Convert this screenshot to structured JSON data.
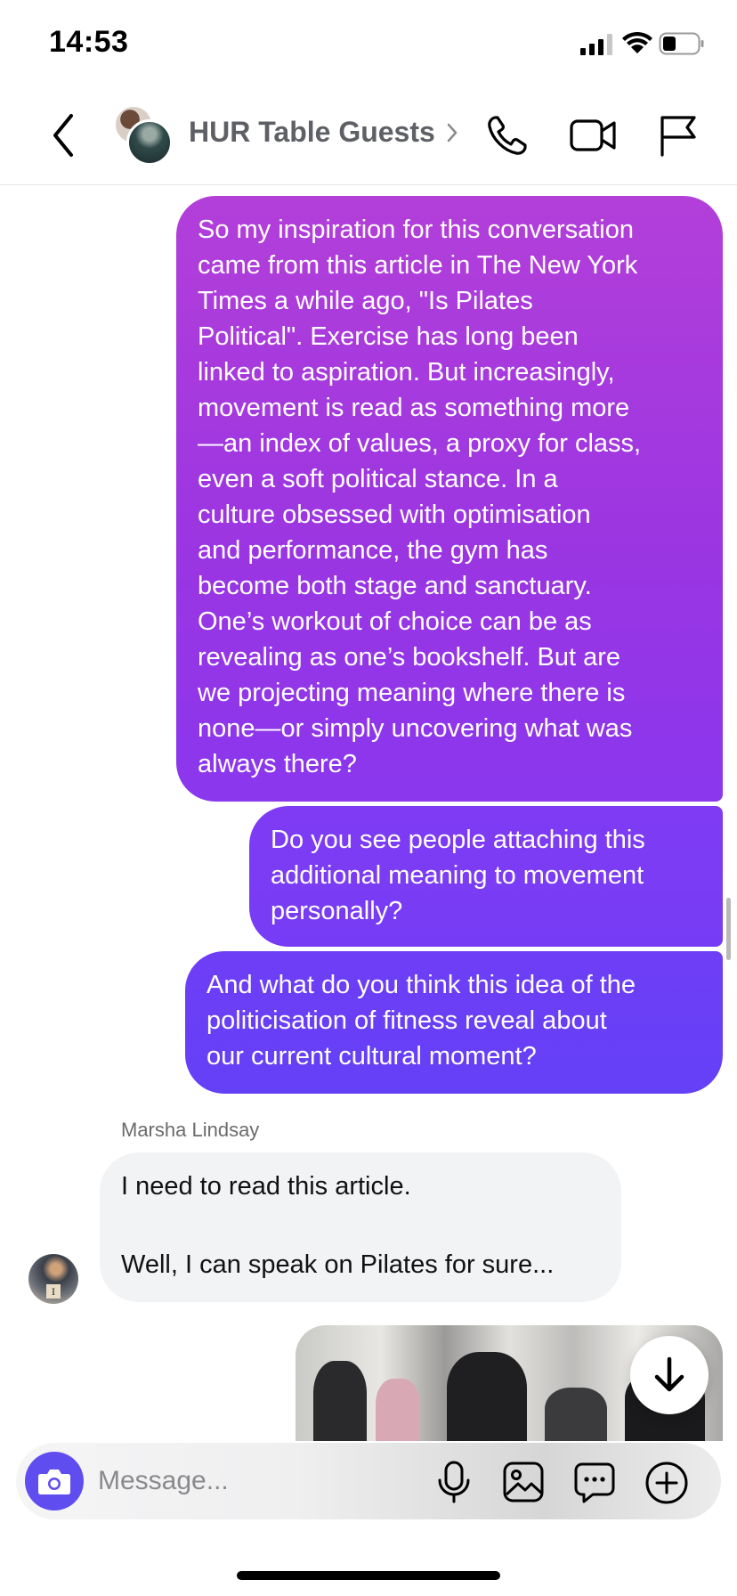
{
  "status_bar": {
    "time": "14:53"
  },
  "header": {
    "title": "HUR Table Guests",
    "icons": [
      "back-arrow-icon",
      "chevron-right-icon",
      "phone-icon",
      "video-camera-icon",
      "flag-icon"
    ]
  },
  "messages": [
    {
      "direction": "outgoing",
      "lines": [
        "So my inspiration for this conversation",
        "came from this article in The New York",
        "Times a while ago, \"Is Pilates",
        "Political\". Exercise has long been",
        "linked to aspiration. But increasingly,",
        "movement is read as something more",
        "—an index of values, a proxy for class,",
        "even a soft political stance. In a",
        "culture obsessed with optimisation",
        "and performance, the gym has",
        "become both stage and sanctuary.",
        "One’s workout of choice can be as",
        "revealing as one’s bookshelf. But are",
        "we projecting meaning where there is",
        "none—or simply uncovering what was",
        "always there?"
      ]
    },
    {
      "direction": "outgoing",
      "lines": [
        "Do you see people attaching this",
        "additional meaning to movement",
        "personally?"
      ]
    },
    {
      "direction": "outgoing",
      "lines": [
        "And what do you think this idea of the",
        "politicisation of fitness reveal about",
        "our current cultural moment?"
      ]
    },
    {
      "direction": "incoming",
      "sender": "Marsha Lindsay",
      "avatar_badge": "I",
      "paragraphs": [
        "I need to read this article.",
        "Well, I can speak on Pilates for sure..."
      ]
    }
  ],
  "composer": {
    "placeholder": "Message...",
    "icons": [
      "camera-icon",
      "microphone-icon",
      "gallery-icon",
      "sticker-icon",
      "plus-icon"
    ]
  },
  "colors": {
    "bubble_gradient_top": "#b33fd9",
    "bubble_gradient_bottom": "#6440f7",
    "incoming_bubble": "#f2f3f5",
    "camera_button": "#5f4df0"
  }
}
